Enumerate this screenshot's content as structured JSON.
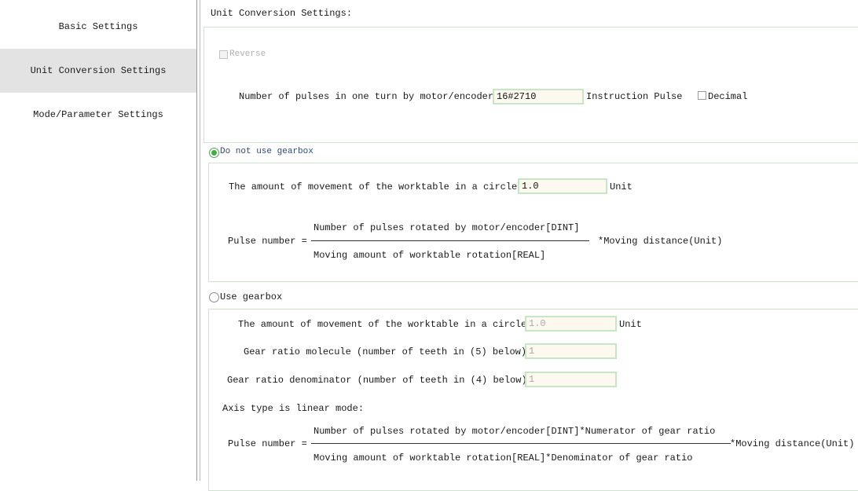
{
  "sidebar": {
    "items": [
      {
        "label": "Basic Settings",
        "active": false
      },
      {
        "label": "Unit Conversion Settings",
        "active": true
      },
      {
        "label": "Mode/Parameter Settings",
        "active": false
      }
    ]
  },
  "header": {
    "title": "Unit Conversion Settings:"
  },
  "reverse": {
    "label": "Reverse",
    "checked": false,
    "enabled": false
  },
  "pulses": {
    "label": "Number of pulses in one turn by motor/encoder:",
    "value": "16#2710",
    "unit": "Instruction Pulse",
    "decimal_label": "Decimal",
    "decimal_checked": false
  },
  "no_gearbox": {
    "label": "Do not use gearbox",
    "selected": true,
    "movement_label": "The amount of movement of the worktable in a circle:",
    "movement_value": "1.0",
    "movement_unit": "Unit",
    "formula": {
      "lhs": "Pulse number =",
      "numerator": "Number of pulses rotated by motor/encoder[DINT]",
      "denominator": "Moving amount of worktable rotation[REAL]",
      "rhs": "*Moving distance(Unit)"
    }
  },
  "gearbox": {
    "label": "Use gearbox",
    "selected": false,
    "movement_label": "The amount of movement of the worktable in a circle:",
    "movement_value": "1.0",
    "movement_unit": "Unit",
    "molecule_label": "Gear ratio molecule (number of teeth in (5) below):",
    "molecule_value": "1",
    "denominator_label": "Gear ratio denominator (number of teeth in (4) below):",
    "denominator_value": "1",
    "axis_type": "Axis type is linear mode:",
    "formula": {
      "lhs": "Pulse number =",
      "numerator": "Number of pulses rotated by motor/encoder[DINT]*Numerator of gear ratio",
      "denominator": "Moving amount of worktable rotation[REAL]*Denominator of gear ratio",
      "rhs": "*Moving distance(Unit)"
    }
  }
}
